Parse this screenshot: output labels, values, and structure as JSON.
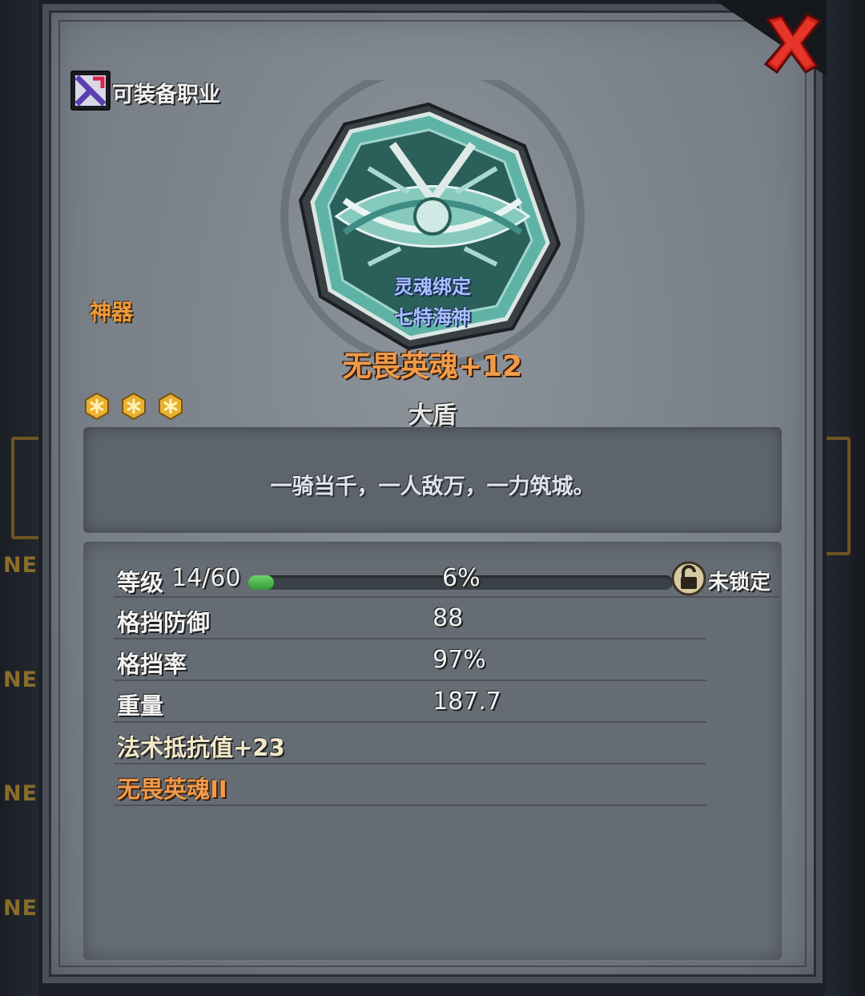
{
  "header": {
    "job_label": "可装备职业",
    "close_icon": "close-x-icon"
  },
  "item": {
    "category": "神器",
    "binding_line1": "灵魂绑定",
    "binding_line2": "七特海神",
    "name": "无畏英魂+12",
    "type": "大盾",
    "star_count": 3,
    "description": "一骑当千，一人敌万，一力筑城。"
  },
  "stats": {
    "level_label": "等级",
    "level_value": "14/60",
    "exp_percent_text": "6%",
    "exp_fraction": 0.06,
    "lock_label": "未锁定",
    "rows": [
      {
        "label": "格挡防御",
        "value": "88"
      },
      {
        "label": "格挡率",
        "value": "97%"
      },
      {
        "label": "重量",
        "value": "187.7"
      }
    ],
    "magic_resist": "法术抵抗值+23",
    "skill": "无畏英魂II"
  },
  "background": {
    "tags": [
      "NE",
      "NE",
      "NE",
      "NE"
    ]
  },
  "colors": {
    "orange": "#f09b4a",
    "blue_binding": "#a9c0ff",
    "exp_green": "#4fbf4a",
    "close_red": "#c8201a"
  }
}
